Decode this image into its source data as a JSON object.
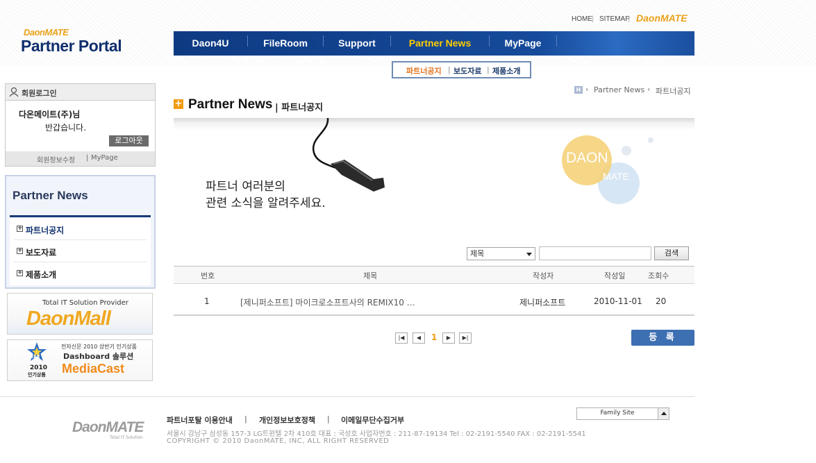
{
  "logo": {
    "brand": "DaonMATE",
    "title": "Partner Portal"
  },
  "util_links": {
    "home": "HOME",
    "sitemap": "SITEMAP",
    "brand": "DaonMATE"
  },
  "nav": [
    {
      "label": "Daon4U"
    },
    {
      "label": "FileRoom"
    },
    {
      "label": "Support"
    },
    {
      "label": "Partner News",
      "active": true
    },
    {
      "label": "MyPage"
    }
  ],
  "submenu": [
    {
      "label": "파트너공지",
      "active": true
    },
    {
      "label": "보도자료"
    },
    {
      "label": "제품소개"
    }
  ],
  "login": {
    "header": "회원로그인",
    "user": "다온메이트(주)님",
    "greeting": "반갑습니다.",
    "logout": "로그아웃",
    "edit_info": "회원정보수정",
    "mypage": "MyPage"
  },
  "left_menu": {
    "title": "Partner News",
    "items": [
      {
        "label": "파트너공지"
      },
      {
        "label": "보도자료"
      },
      {
        "label": "제품소개"
      }
    ]
  },
  "banners": {
    "mall_caption": "Total IT Solution Provider",
    "mall_name": "DaonMall",
    "media_caption": "전자신문 2010 상반기 인기상품",
    "media_award_year": "2010",
    "media_award_label": "인기상품",
    "media_award_star": "STAR",
    "media_line": "Dashboard 솔루션",
    "media_name": "MediaCast"
  },
  "breadcrumb": {
    "home_icon": "H",
    "section": "Partner News",
    "current": "파트너공지"
  },
  "page": {
    "title": "Partner News",
    "subtitle": "| 파트너공지"
  },
  "visual": {
    "message_line1": "파트너 여러분의",
    "message_line2": "관련 소식을 알려주세요.",
    "circle_top": "DAON",
    "circle_bottom": "MATE"
  },
  "search": {
    "field": "제목",
    "button": "검색",
    "query": ""
  },
  "table": {
    "headers": [
      "번호",
      "제목",
      "작성자",
      "작성일",
      "조회수"
    ],
    "rows": [
      {
        "no": "1",
        "title": "[제니퍼소프트] 마이크로소프트사의 REMIX10 …",
        "author": "제니퍼소프트",
        "date": "2010-11-01",
        "views": "20"
      }
    ]
  },
  "pager": {
    "current": "1"
  },
  "write_button": "등 록",
  "footer": {
    "logo": "DaonMATE",
    "logo_sub": "Total IT Solution",
    "links": [
      "파트너포탈 이용안내",
      "개인정보보호정책",
      "이메일무단수집거부"
    ],
    "separator": "|",
    "address": "서울시 강남구 삼성동 157-3 LG트윈텔 2차 410호   대표 : 국성호  사업자번호 : 211-87-19134    Tel : 02-2191-5540    FAX : 02-2191-5541",
    "copyright": "COPYRIGHT © 2010 DaonMATE, INC, ALL RIGHT RESERVED",
    "family_site": "Family Site"
  },
  "colors": {
    "nav_bg": "#164a9a",
    "nav_active": "#ffcc00",
    "accent_orange": "#f39c12",
    "write_button": "#3d6fb3"
  }
}
